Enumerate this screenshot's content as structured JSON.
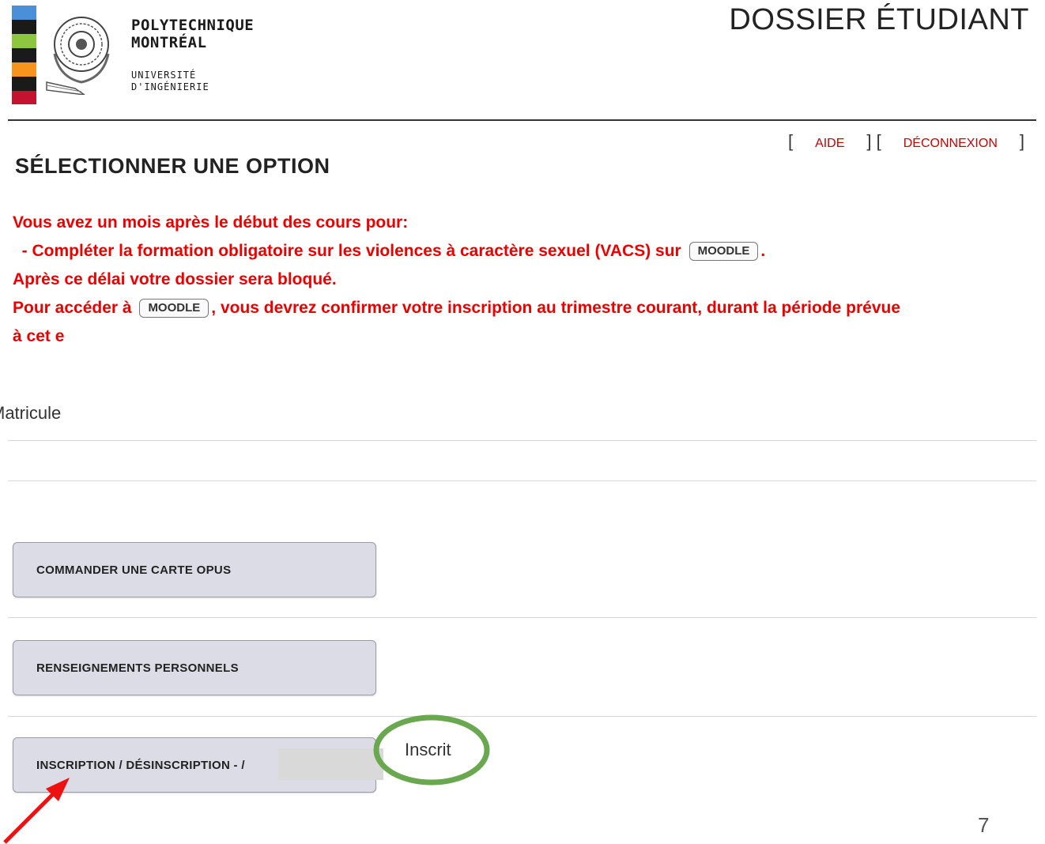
{
  "logo": {
    "name_line1": "POLYTECHNIQUE",
    "name_line2": "MONTRÉAL",
    "sub_line1": "UNIVERSITÉ",
    "sub_line2": "D'INGÉNIERIE",
    "strip_colors": [
      "#4a90d9",
      "#1a1a1a",
      "#8dc63f",
      "#1a1a1a",
      "#f7941d",
      "#1a1a1a",
      "#c4122f"
    ]
  },
  "header": {
    "title": "DOSSIER ÉTUDIANT"
  },
  "top_links": {
    "open_bracket": "[",
    "mid_bracket": "] [",
    "close_bracket": "]",
    "help": "AIDE",
    "logout": "DÉCONNEXION"
  },
  "section_title": "SÉLECTIONNER UNE OPTION",
  "notice": {
    "line1": "Vous avez un mois après le début des cours pour:",
    "line2_pre": "- Compléter la formation obligatoire sur les violences à caractère sexuel (VACS) sur",
    "line2_post": ".",
    "line3": "Après ce délai votre dossier sera bloqué.",
    "line4_pre": "Pour accéder à",
    "line4_post": ", vous devrez confirmer votre inscription au trimestre courant, durant la période prévue",
    "line5": "à cet e",
    "moodle_label": "MOODLE"
  },
  "matricule_label": "Matricule",
  "options": [
    {
      "label": "COMMANDER UNE CARTE OPUS"
    },
    {
      "label": "RENSEIGNEMENTS PERSONNELS"
    },
    {
      "label": "INSCRIPTION / DÉSINSCRIPTION - /"
    }
  ],
  "registration_status": "Inscrit",
  "annotation_colors": {
    "circle": "#6aa84f",
    "arrow": "#ee1111"
  },
  "slide_number": "7"
}
